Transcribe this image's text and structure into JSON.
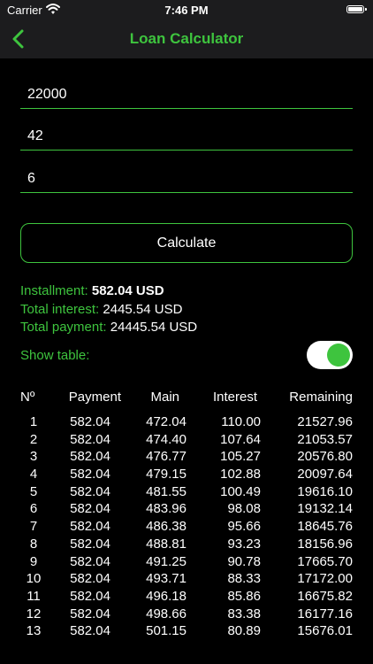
{
  "status": {
    "carrier": "Carrier",
    "time": "7:46 PM"
  },
  "nav": {
    "title": "Loan Calculator",
    "back_icon": "chevron-left-icon"
  },
  "form": {
    "amount": "22000",
    "months": "42",
    "rate": "6",
    "calculate_label": "Calculate"
  },
  "summary": {
    "installment_label": "Installment:",
    "installment_value": "582.04 USD",
    "interest_label": "Total interest:",
    "interest_value": "2445.54 USD",
    "payment_label": "Total payment:",
    "payment_value": "24445.54 USD"
  },
  "toggle": {
    "label": "Show table:",
    "on": true
  },
  "colors": {
    "accent": "#3ec43e",
    "bar": "#1c1c1e",
    "background": "#000000"
  },
  "table": {
    "headers": [
      "Nº",
      "Payment",
      "Main",
      "Interest",
      "Remaining"
    ],
    "rows": [
      [
        "1",
        "582.04",
        "472.04",
        "110.00",
        "21527.96"
      ],
      [
        "2",
        "582.04",
        "474.40",
        "107.64",
        "21053.57"
      ],
      [
        "3",
        "582.04",
        "476.77",
        "105.27",
        "20576.80"
      ],
      [
        "4",
        "582.04",
        "479.15",
        "102.88",
        "20097.64"
      ],
      [
        "5",
        "582.04",
        "481.55",
        "100.49",
        "19616.10"
      ],
      [
        "6",
        "582.04",
        "483.96",
        "98.08",
        "19132.14"
      ],
      [
        "7",
        "582.04",
        "486.38",
        "95.66",
        "18645.76"
      ],
      [
        "8",
        "582.04",
        "488.81",
        "93.23",
        "18156.96"
      ],
      [
        "9",
        "582.04",
        "491.25",
        "90.78",
        "17665.70"
      ],
      [
        "10",
        "582.04",
        "493.71",
        "88.33",
        "17172.00"
      ],
      [
        "11",
        "582.04",
        "496.18",
        "85.86",
        "16675.82"
      ],
      [
        "12",
        "582.04",
        "498.66",
        "83.38",
        "16177.16"
      ],
      [
        "13",
        "582.04",
        "501.15",
        "80.89",
        "15676.01"
      ]
    ]
  }
}
